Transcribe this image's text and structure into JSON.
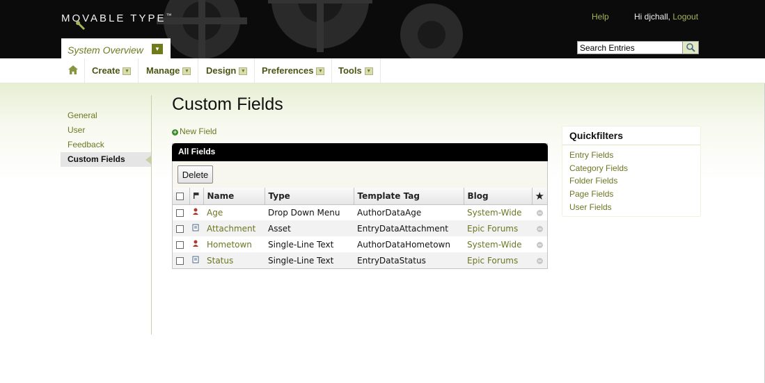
{
  "header": {
    "logo_text": "MOVABLE TYPE",
    "logo_tm": "™",
    "help_label": "Help",
    "greeting": "Hi djchall, ",
    "logout_label": "Logout",
    "scope_label": "System Overview",
    "search_value": "Search Entries"
  },
  "nav": {
    "items": [
      {
        "label": "Create"
      },
      {
        "label": "Manage"
      },
      {
        "label": "Design"
      },
      {
        "label": "Preferences"
      },
      {
        "label": "Tools"
      }
    ]
  },
  "sidebar": {
    "items": [
      {
        "label": "General"
      },
      {
        "label": "User"
      },
      {
        "label": "Feedback"
      },
      {
        "label": "Custom Fields"
      }
    ]
  },
  "main": {
    "title": "Custom Fields",
    "new_field_label": "New Field",
    "listing_title": "All Fields",
    "delete_label": "Delete",
    "columns": [
      "Name",
      "Type",
      "Template Tag",
      "Blog"
    ],
    "star_label": "★",
    "rows": [
      {
        "name": "Age",
        "type": "Drop Down Menu",
        "tag": "AuthorDataAge",
        "blog": "System-Wide",
        "icon": "user-icon"
      },
      {
        "name": "Attachment",
        "type": "Asset",
        "tag": "EntryDataAttachment",
        "blog": "Epic Forums",
        "icon": "document-icon"
      },
      {
        "name": "Hometown",
        "type": "Single-Line Text",
        "tag": "AuthorDataHometown",
        "blog": "System-Wide",
        "icon": "user-icon"
      },
      {
        "name": "Status",
        "type": "Single-Line Text",
        "tag": "EntryDataStatus",
        "blog": "Epic Forums",
        "icon": "document-icon"
      }
    ]
  },
  "quickfilters": {
    "title": "Quickfilters",
    "items": [
      "Entry Fields",
      "Category Fields",
      "Folder Fields",
      "Page Fields",
      "User Fields"
    ]
  },
  "colors": {
    "link": "#6d7622",
    "header_bg": "#0b0b0b",
    "accent": "#a8b35a"
  }
}
